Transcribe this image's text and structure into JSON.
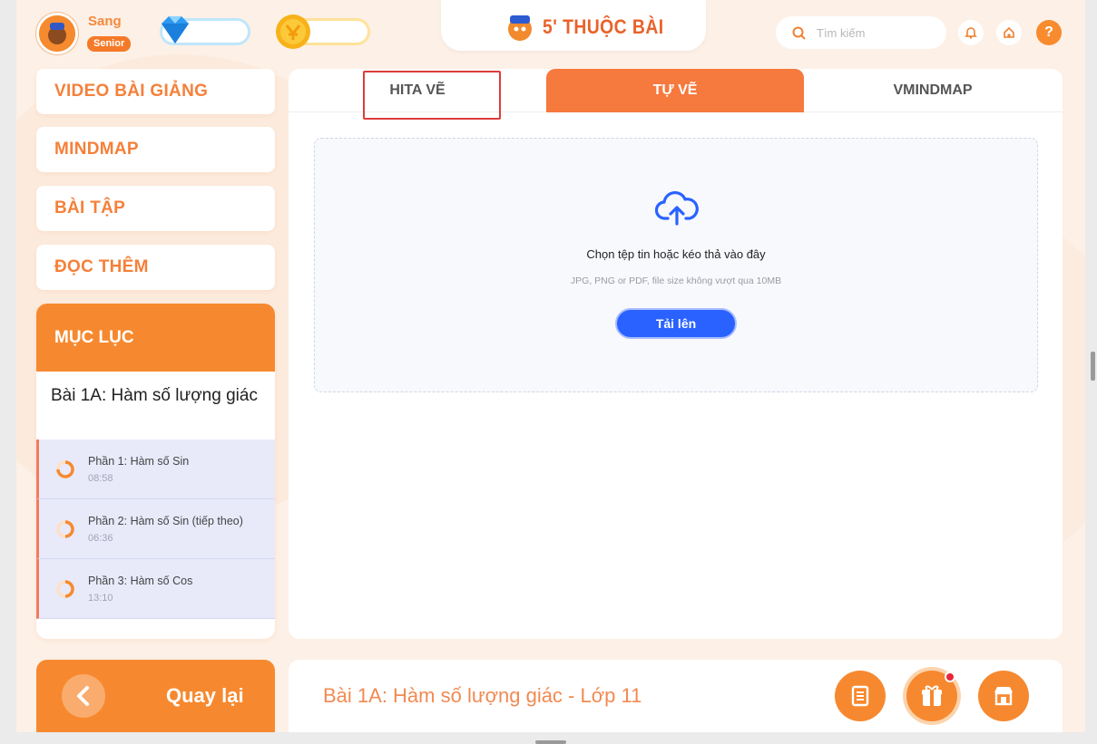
{
  "header": {
    "username": "Sang",
    "rank": "Senior",
    "logo_text": "5' THUỘC BÀI",
    "search_placeholder": "Tìm kiếm",
    "help_label": "?"
  },
  "sidebar": {
    "menu": [
      {
        "label": "VIDEO BÀI GIẢNG"
      },
      {
        "label": "MINDMAP"
      },
      {
        "label": "BÀI TẬP"
      },
      {
        "label": "ĐỌC THÊM"
      }
    ],
    "toc": {
      "title": "MỤC LỤC",
      "lesson": "Bài 1A: Hàm số lượng giác",
      "parts": [
        {
          "title": "Phần 1: Hàm số Sin",
          "time": "08:58"
        },
        {
          "title": "Phần 2: Hàm số Sin (tiếp theo)",
          "time": "06:36"
        },
        {
          "title": "Phần 3: Hàm số Cos",
          "time": "13:10"
        }
      ]
    },
    "back_label": "Quay lại"
  },
  "main": {
    "tabs": [
      {
        "label": "HITA VẼ",
        "active": false
      },
      {
        "label": "TỰ VẼ",
        "active": true
      },
      {
        "label": "VMINDMAP",
        "active": false
      }
    ],
    "upload": {
      "title": "Chọn tệp tin hoặc kéo thả vào đây",
      "note": "JPG, PNG or PDF, file size không vượt qua 10MB",
      "button": "Tải lên"
    }
  },
  "footer": {
    "title": "Bài 1A: Hàm số lượng giác - Lớp 11",
    "actions": [
      "notebook-icon",
      "gift-icon",
      "shop-icon"
    ]
  },
  "colors": {
    "accent": "#f6892f",
    "tab_active": "#f6793e",
    "upload_button": "#2962ff",
    "highlight": "#de3b3b"
  }
}
